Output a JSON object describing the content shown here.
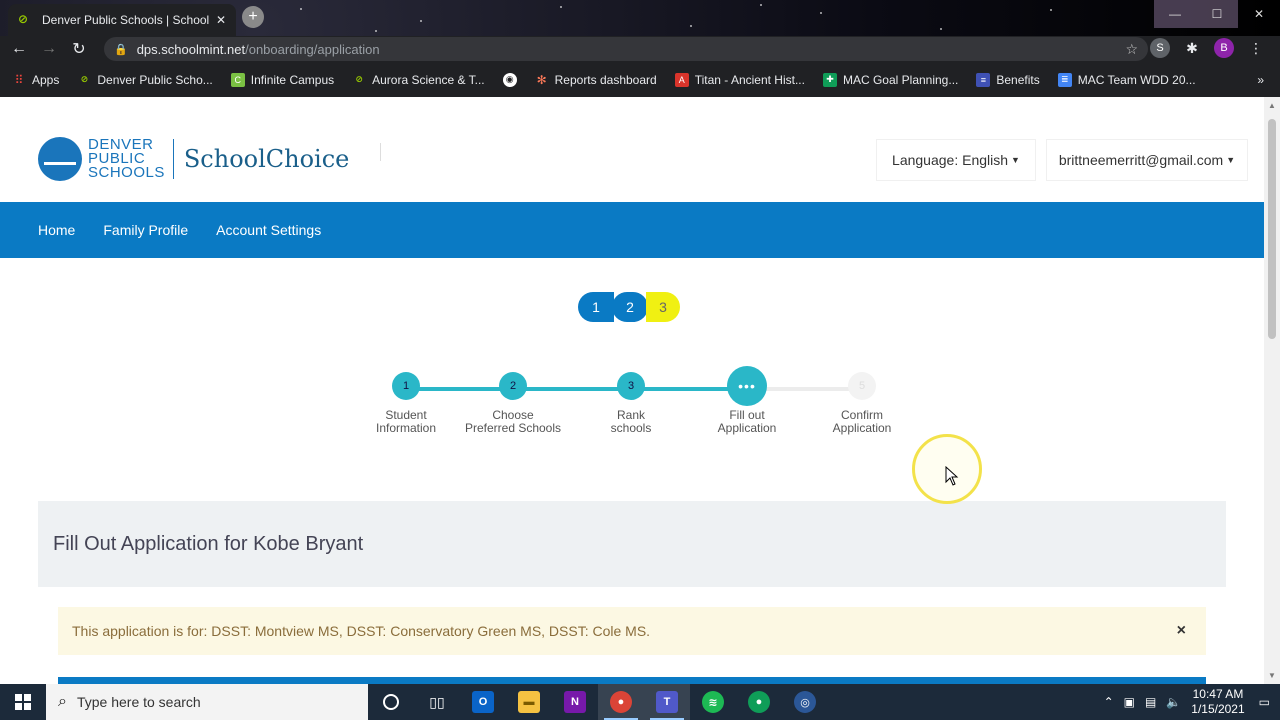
{
  "browser": {
    "tab_title": "Denver Public Schools | SchoolMint",
    "tab_close": "✕",
    "new_tab": "+",
    "url_host": "dps.schoolmint.net",
    "url_path": "/onboarding/application",
    "profile_initial": "B",
    "extension_initial": "S",
    "bookmarks": [
      {
        "label": "Apps",
        "icon": "apps-grid-icon",
        "color": "#e8453c"
      },
      {
        "label": "Denver Public Scho...",
        "icon": "schoolmint-icon",
        "color": "#9c0"
      },
      {
        "label": "Infinite Campus",
        "icon": "infinite-campus-icon",
        "color": "#7ac143"
      },
      {
        "label": "Aurora Science & T...",
        "icon": "schoolmint-icon",
        "color": "#9c0"
      },
      {
        "label": "",
        "icon": "globe-icon",
        "color": "#fff"
      },
      {
        "label": "Reports dashboard",
        "icon": "hubspot-icon",
        "color": "#ff7a59"
      },
      {
        "label": "Titan - Ancient Hist...",
        "icon": "titan-icon",
        "color": "#d9342b"
      },
      {
        "label": "MAC Goal Planning...",
        "icon": "sheets-icon",
        "color": "#0f9d58"
      },
      {
        "label": "Benefits",
        "icon": "forms-icon",
        "color": "#3f51b5"
      },
      {
        "label": "MAC Team WDD 20...",
        "icon": "docs-icon",
        "color": "#4285f4"
      }
    ],
    "bookmarks_more": "»"
  },
  "header": {
    "logo_line1": "DENVER",
    "logo_line2": "PUBLIC",
    "logo_line3": "SCHOOLS",
    "product": "SchoolChoice",
    "language_label": "Language:",
    "language_value": "English",
    "user_email": "brittneemerritt@gmail.com"
  },
  "nav": {
    "items": [
      {
        "label": "Home"
      },
      {
        "label": "Family Profile"
      },
      {
        "label": "Account Settings"
      }
    ]
  },
  "pager": {
    "pages": [
      "1",
      "2",
      "3"
    ],
    "active": "3"
  },
  "steps": [
    {
      "num": "1",
      "line1": "Student",
      "line2": "Information",
      "state": "done"
    },
    {
      "num": "2",
      "line1": "Choose",
      "line2": "Preferred Schools",
      "state": "done"
    },
    {
      "num": "3",
      "line1": "Rank",
      "line2": "schools",
      "state": "done"
    },
    {
      "num": "•••",
      "line1": "Fill out",
      "line2": "Application",
      "state": "current"
    },
    {
      "num": "5",
      "line1": "Confirm",
      "line2": "Application",
      "state": "todo"
    }
  ],
  "main": {
    "panel_title": "Fill Out Application for Kobe Bryant",
    "alert_text": "This application is for: DSST: Montview MS, DSST: Conservatory Green MS, DSST: Cole MS.",
    "alert_close": "×"
  },
  "taskbar": {
    "search_placeholder": "Type here to search",
    "time": "10:47 AM",
    "date": "1/15/2021",
    "apps": [
      {
        "name": "cortana-icon"
      },
      {
        "name": "task-view-icon"
      },
      {
        "name": "outlook-icon"
      },
      {
        "name": "file-explorer-icon"
      },
      {
        "name": "onenote-icon"
      },
      {
        "name": "chrome-icon"
      },
      {
        "name": "teams-icon"
      },
      {
        "name": "spotify-icon"
      },
      {
        "name": "chrome-alt-icon"
      },
      {
        "name": "recorder-icon"
      }
    ]
  },
  "colors": {
    "brand_blue": "#0a7ac4",
    "step_teal": "#2ab7c8",
    "pager_active": "#f0f012",
    "alert_bg": "#fcf8e3",
    "alert_text": "#8a6d3b"
  }
}
